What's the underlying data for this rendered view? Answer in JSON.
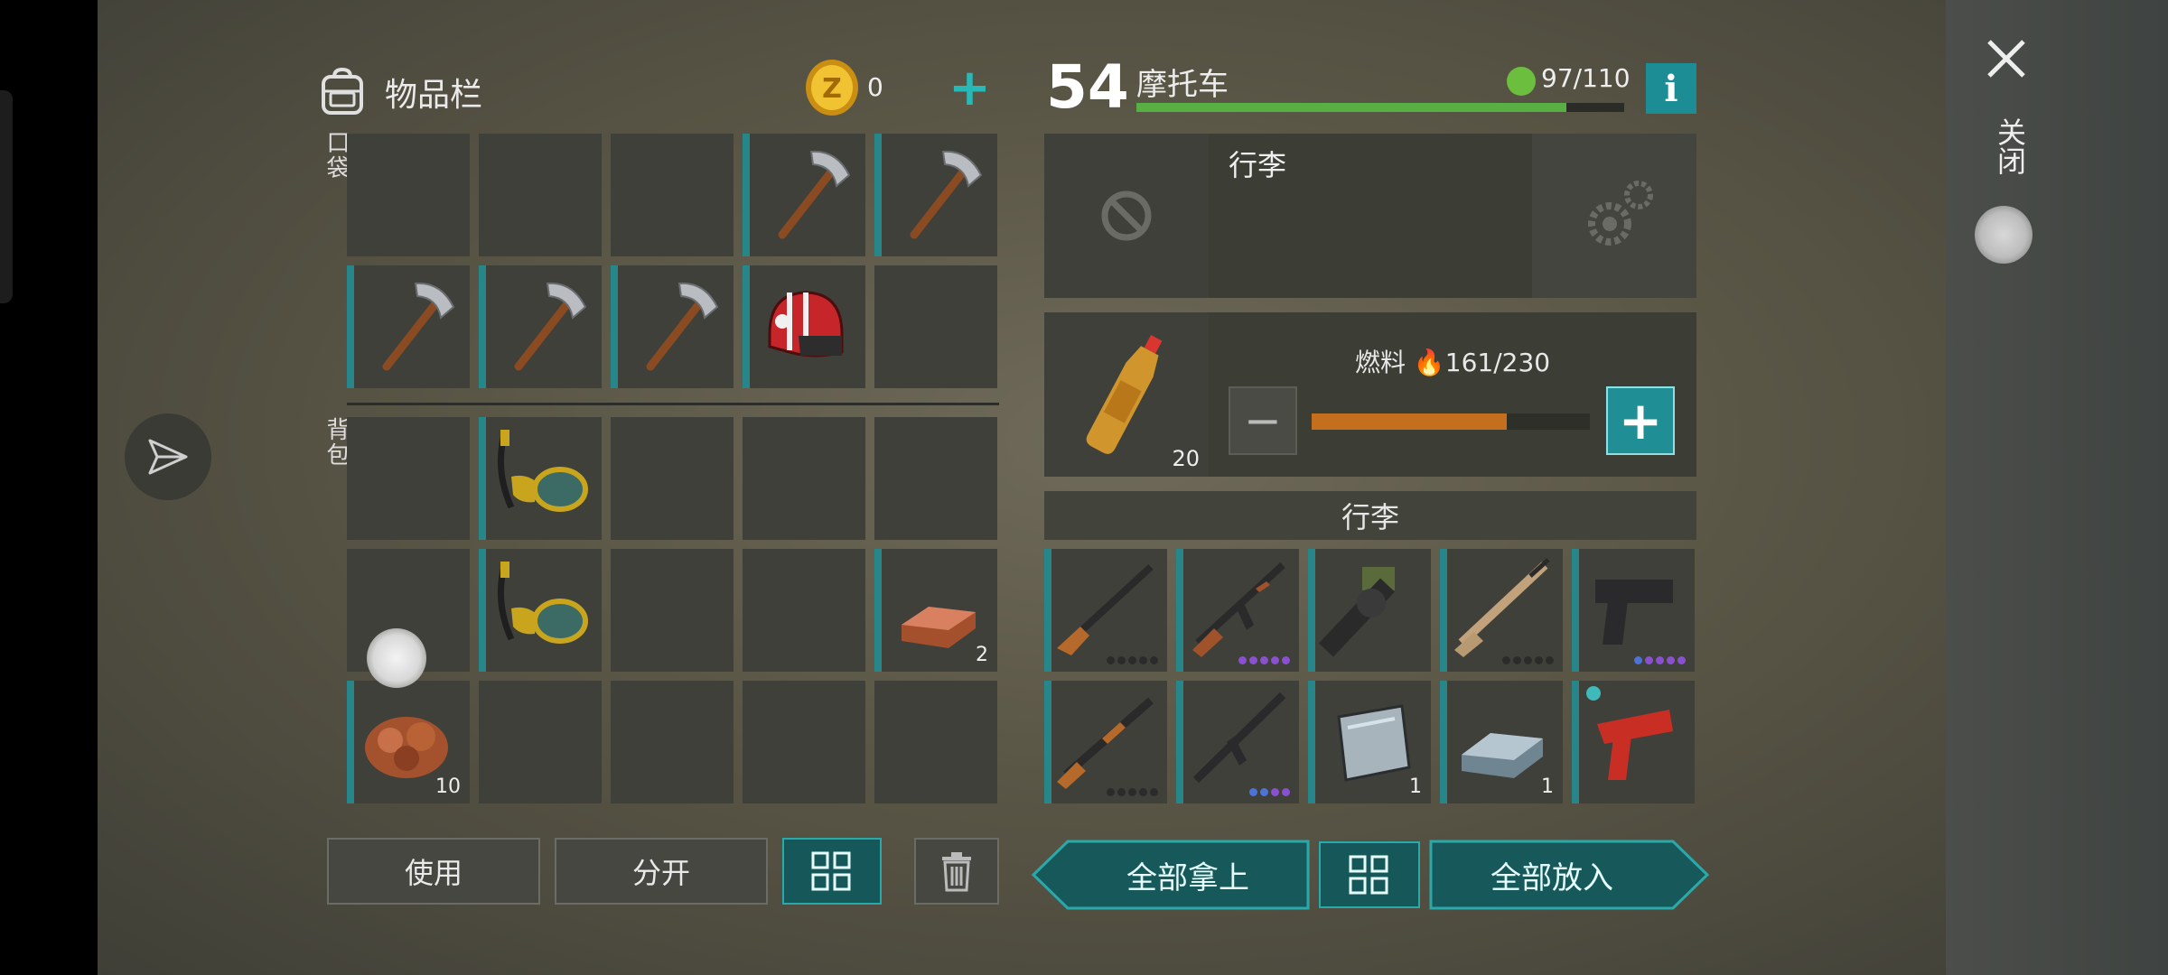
{
  "inventory": {
    "title": "物品栏",
    "coins": "0",
    "pocket_label": "口袋",
    "backpack_label": "背包",
    "pocket_slots": [
      {
        "item": "",
        "qty": ""
      },
      {
        "item": "",
        "qty": ""
      },
      {
        "item": "",
        "qty": ""
      },
      {
        "item": "pickaxe",
        "qty": "",
        "durability": 0.88
      },
      {
        "item": "pickaxe",
        "qty": "",
        "durability": 1.0
      },
      {
        "item": "pickaxe",
        "qty": "",
        "durability": 1.0
      },
      {
        "item": "pickaxe",
        "qty": "",
        "durability": 1.0
      },
      {
        "item": "pickaxe",
        "qty": "",
        "durability": 1.0
      },
      {
        "item": "red-helmet",
        "qty": "",
        "durability": 1.0
      },
      {
        "item": "",
        "qty": ""
      }
    ],
    "backpack_slots": [
      {
        "item": "",
        "qty": ""
      },
      {
        "item": "diving-goggles",
        "qty": "",
        "durability": 1.0
      },
      {
        "item": "",
        "qty": ""
      },
      {
        "item": "",
        "qty": ""
      },
      {
        "item": "",
        "qty": ""
      },
      {
        "item": "",
        "qty": ""
      },
      {
        "item": "diving-goggles",
        "qty": "",
        "durability": 1.0
      },
      {
        "item": "",
        "qty": ""
      },
      {
        "item": "",
        "qty": ""
      },
      {
        "item": "copper-ingot",
        "qty": "2"
      },
      {
        "item": "copper-ore",
        "qty": "10"
      },
      {
        "item": "",
        "qty": ""
      },
      {
        "item": "",
        "qty": ""
      },
      {
        "item": "",
        "qty": ""
      },
      {
        "item": "",
        "qty": ""
      }
    ],
    "buttons": {
      "use": "使用",
      "split": "分开"
    }
  },
  "vehicle": {
    "level": "54",
    "name": "摩托车",
    "hp_text": "97/110",
    "hp_fraction": 0.882,
    "info_label": "i",
    "section_label": "行李",
    "fuel_item_qty": "20",
    "fuel_label": "燃料",
    "fuel_text": "161/230",
    "fuel_fraction": 0.7,
    "trunk_title": "行李",
    "trunk_slots": [
      {
        "item": "hunting-rifle",
        "qty": "",
        "dots": [
          "n",
          "n",
          "n",
          "n",
          "n"
        ]
      },
      {
        "item": "ak-rifle",
        "qty": "",
        "dots": [
          "p",
          "p",
          "p",
          "p",
          "p"
        ]
      },
      {
        "item": "grenade-launcher",
        "qty": "",
        "dots": []
      },
      {
        "item": "assault-rifle",
        "qty": "",
        "dots": [
          "n",
          "n",
          "n",
          "n",
          "n"
        ]
      },
      {
        "item": "pistol",
        "qty": "",
        "dots": [
          "b",
          "p",
          "p",
          "p",
          "p"
        ]
      },
      {
        "item": "shotgun",
        "qty": "",
        "dots": [
          "n",
          "n",
          "n",
          "n",
          "n"
        ]
      },
      {
        "item": "m16-rifle",
        "qty": "",
        "dots": [
          "b",
          "b",
          "p",
          "p"
        ]
      },
      {
        "item": "metal-plate",
        "qty": "1",
        "dots": []
      },
      {
        "item": "iron-ingot",
        "qty": "1",
        "dots": []
      },
      {
        "item": "flare-gun",
        "qty": "",
        "dots": []
      }
    ],
    "buttons": {
      "take_all": "全部拿上",
      "put_all": "全部放入"
    }
  },
  "close_label": "关闭",
  "colors": {
    "accent": "#28b8b8",
    "hp": "#58b045",
    "fuel": "#c36f1d"
  }
}
